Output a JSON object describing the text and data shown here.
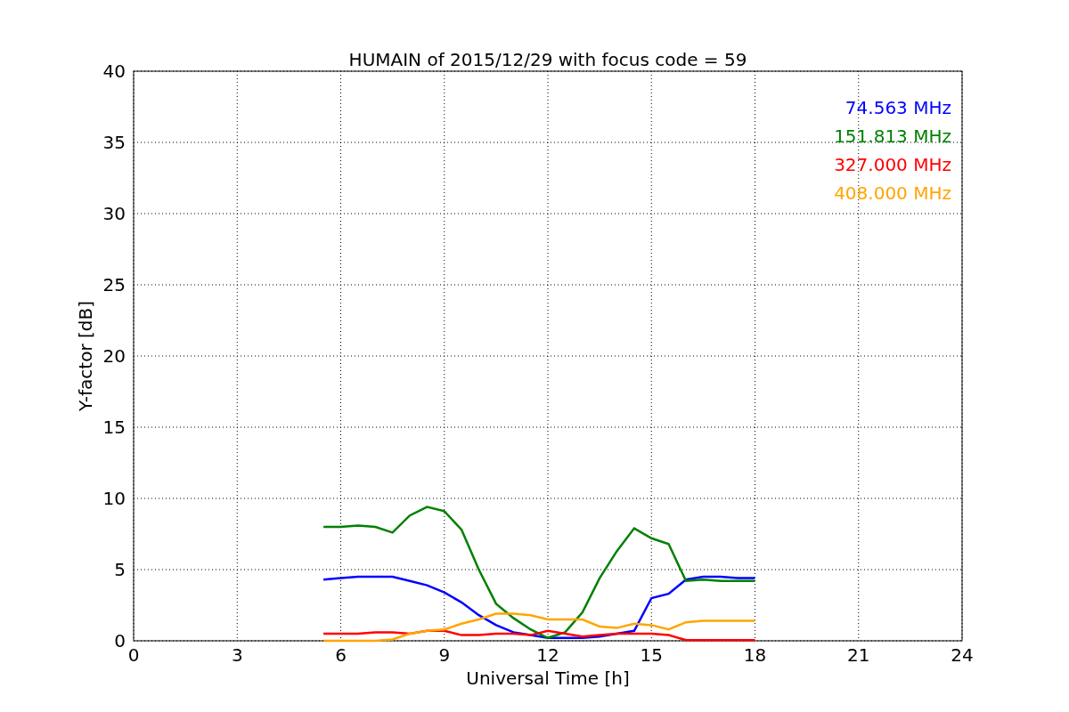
{
  "figure": {
    "chart_data": {
      "type": "line",
      "title": "HUMAIN of 2015/12/29 with focus code = 59",
      "xlabel": "Universal Time [h]",
      "ylabel": "Y-factor [dB]",
      "x": [
        5.5,
        6,
        6.5,
        7,
        7.5,
        8,
        8.5,
        9,
        9.5,
        10,
        10.5,
        11,
        11.5,
        12,
        12.5,
        13,
        13.5,
        14,
        14.5,
        15,
        15.5,
        16,
        16.5,
        17,
        17.5,
        18
      ],
      "series": [
        {
          "name": "74.563 MHz",
          "color": "#0000ff",
          "values": [
            4.3,
            4.4,
            4.5,
            4.5,
            4.5,
            4.2,
            3.9,
            3.4,
            2.7,
            1.8,
            1.1,
            0.6,
            0.4,
            0.2,
            0.2,
            0.2,
            0.3,
            0.5,
            0.7,
            3.0,
            3.3,
            4.3,
            4.5,
            4.5,
            4.4,
            4.4
          ]
        },
        {
          "name": "151.813 MHz",
          "color": "#008000",
          "values": [
            8.0,
            8.0,
            8.1,
            8.0,
            7.6,
            8.8,
            9.4,
            9.1,
            7.8,
            5.0,
            2.6,
            1.6,
            0.8,
            0.2,
            0.6,
            2.0,
            4.4,
            6.3,
            7.9,
            7.2,
            6.8,
            4.2,
            4.3,
            4.2,
            4.2,
            4.2
          ]
        },
        {
          "name": "327.000 MHz",
          "color": "#ff0000",
          "values": [
            0.5,
            0.5,
            0.5,
            0.6,
            0.6,
            0.5,
            0.7,
            0.7,
            0.4,
            0.4,
            0.5,
            0.5,
            0.4,
            0.7,
            0.5,
            0.3,
            0.4,
            0.5,
            0.5,
            0.5,
            0.4,
            0.05,
            0.05,
            0.05,
            0.05,
            0.05
          ]
        },
        {
          "name": "408.000 MHz",
          "color": "#ffa500",
          "values": [
            0,
            0,
            0,
            0,
            0.1,
            0.5,
            0.7,
            0.8,
            1.2,
            1.5,
            1.9,
            1.9,
            1.8,
            1.5,
            1.5,
            1.5,
            1.0,
            0.9,
            1.2,
            1.1,
            0.8,
            1.3,
            1.4,
            1.4,
            1.4,
            1.4
          ]
        }
      ],
      "grid": true,
      "xlim": [
        0,
        24
      ],
      "ylim": [
        0,
        40
      ],
      "xticks": [
        0,
        3,
        6,
        9,
        12,
        15,
        18,
        21,
        24
      ],
      "yticks": [
        0,
        5,
        10,
        15,
        20,
        25,
        30,
        35,
        40
      ]
    }
  }
}
